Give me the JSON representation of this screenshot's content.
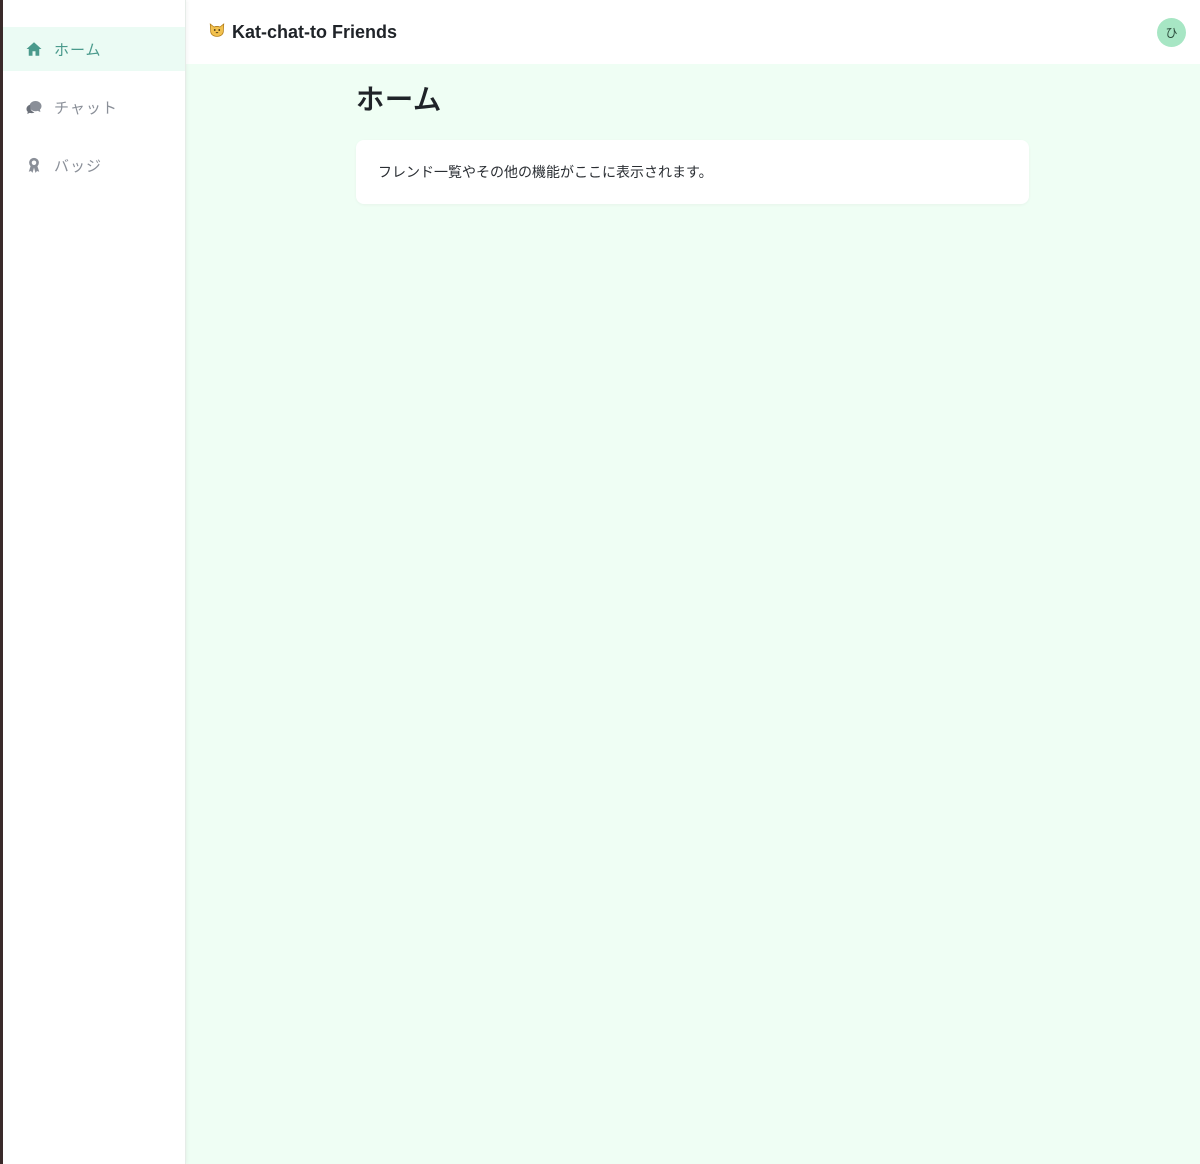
{
  "sidebar": {
    "items": [
      {
        "label": "ホーム",
        "icon": "home-icon",
        "active": true
      },
      {
        "label": "チャット",
        "icon": "chat-bubbles-icon",
        "active": false
      },
      {
        "label": "バッジ",
        "icon": "badge-ribbon-icon",
        "active": false
      }
    ]
  },
  "header": {
    "title": "Kat-chat-to Friends",
    "logo_icon": "cat-face-icon",
    "avatar_initial": "ひ"
  },
  "main": {
    "page_title": "ホーム",
    "card_text": "フレンド一覧やその他の機能がここに表示されます。"
  },
  "colors": {
    "accent": "#4a9a8c",
    "active_bg": "#ebfbf4",
    "content_bg": "#effef4",
    "avatar_bg": "#a7e6c4"
  }
}
